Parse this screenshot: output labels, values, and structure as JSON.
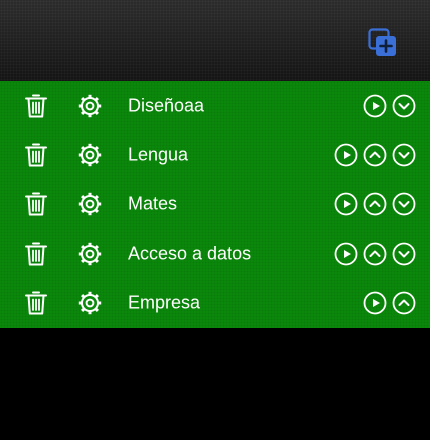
{
  "header": {
    "add_icon": "add-to-collection-icon",
    "accent_color": "#3b6fd8"
  },
  "list": {
    "background_color": "#0b8a0b",
    "items": [
      {
        "label": "Diseñoaa",
        "actions": [
          "play",
          "down"
        ]
      },
      {
        "label": "Lengua",
        "actions": [
          "play",
          "up",
          "down"
        ]
      },
      {
        "label": "Mates",
        "actions": [
          "play",
          "up",
          "down"
        ]
      },
      {
        "label": "Acceso a datos",
        "actions": [
          "play",
          "up",
          "down"
        ]
      },
      {
        "label": "Empresa",
        "actions": [
          "play",
          "up"
        ]
      }
    ]
  }
}
